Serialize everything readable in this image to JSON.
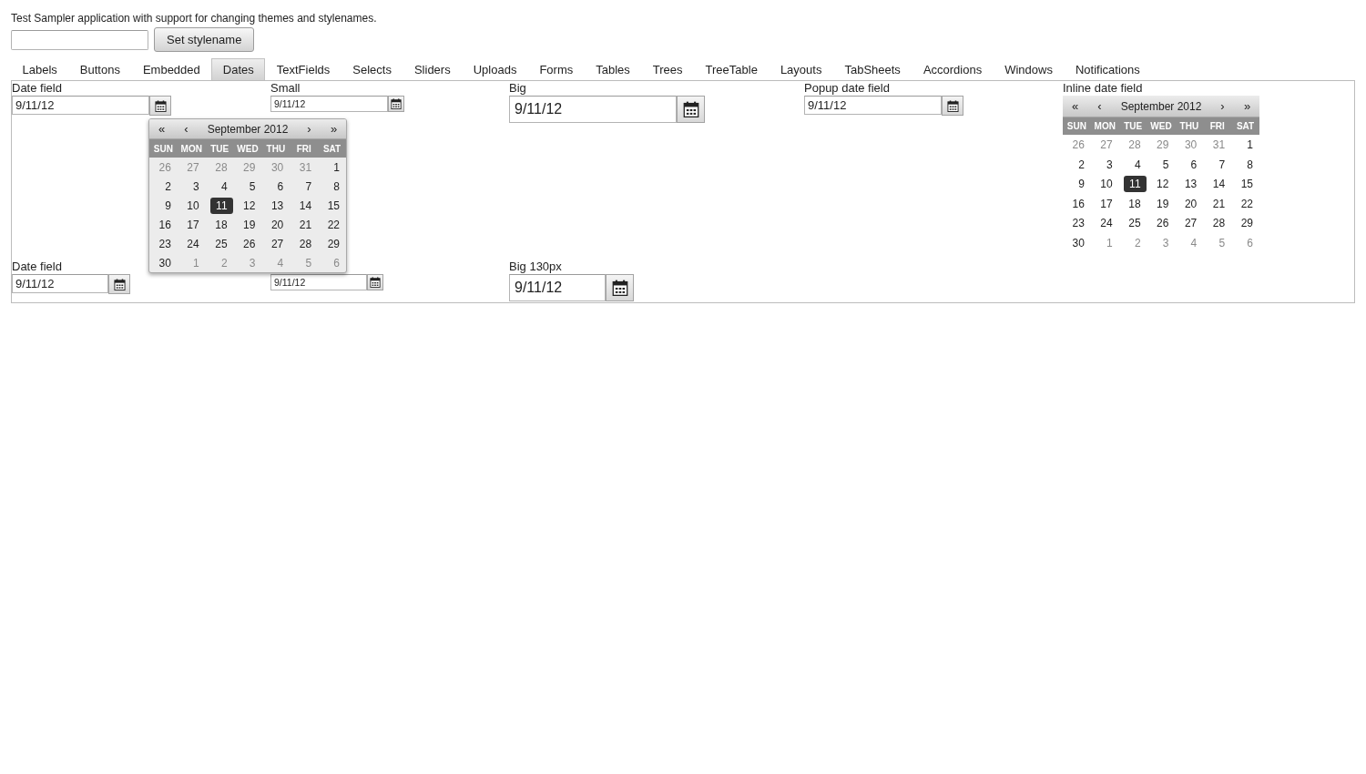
{
  "app": {
    "description": "Test Sampler application with support for changing themes and stylenames.",
    "stylename_button": "Set stylename"
  },
  "tabs": [
    {
      "label": "Labels",
      "selected": false
    },
    {
      "label": "Buttons",
      "selected": false
    },
    {
      "label": "Embedded",
      "selected": false
    },
    {
      "label": "Dates",
      "selected": true
    },
    {
      "label": "TextFields",
      "selected": false
    },
    {
      "label": "Selects",
      "selected": false
    },
    {
      "label": "Sliders",
      "selected": false
    },
    {
      "label": "Uploads",
      "selected": false
    },
    {
      "label": "Forms",
      "selected": false
    },
    {
      "label": "Tables",
      "selected": false
    },
    {
      "label": "Trees",
      "selected": false
    },
    {
      "label": "TreeTable",
      "selected": false
    },
    {
      "label": "Layouts",
      "selected": false
    },
    {
      "label": "TabSheets",
      "selected": false
    },
    {
      "label": "Accordions",
      "selected": false
    },
    {
      "label": "Windows",
      "selected": false
    },
    {
      "label": "Notifications",
      "selected": false
    }
  ],
  "rows": [
    [
      {
        "kind": "default",
        "label": "Date field",
        "value": "9/11/12",
        "popup_calendar": {
          "prev_year": "«",
          "prev_month": "‹",
          "title": "September 2012",
          "next_month": "›",
          "next_year": "»",
          "weekdays": [
            "SUN",
            "MON",
            "TUE",
            "WED",
            "THU",
            "FRI",
            "SAT"
          ],
          "weeks": [
            [
              {
                "day": "26",
                "other_month": true,
                "selected": false
              },
              {
                "day": "27",
                "other_month": true,
                "selected": false
              },
              {
                "day": "28",
                "other_month": true,
                "selected": false
              },
              {
                "day": "29",
                "other_month": true,
                "selected": false
              },
              {
                "day": "30",
                "other_month": true,
                "selected": false
              },
              {
                "day": "31",
                "other_month": true,
                "selected": false
              },
              {
                "day": "1",
                "other_month": false,
                "selected": false
              }
            ],
            [
              {
                "day": "2",
                "other_month": false,
                "selected": false
              },
              {
                "day": "3",
                "other_month": false,
                "selected": false
              },
              {
                "day": "4",
                "other_month": false,
                "selected": false
              },
              {
                "day": "5",
                "other_month": false,
                "selected": false
              },
              {
                "day": "6",
                "other_month": false,
                "selected": false
              },
              {
                "day": "7",
                "other_month": false,
                "selected": false
              },
              {
                "day": "8",
                "other_month": false,
                "selected": false
              }
            ],
            [
              {
                "day": "9",
                "other_month": false,
                "selected": false
              },
              {
                "day": "10",
                "other_month": false,
                "selected": false
              },
              {
                "day": "11",
                "other_month": false,
                "selected": true
              },
              {
                "day": "12",
                "other_month": false,
                "selected": false
              },
              {
                "day": "13",
                "other_month": false,
                "selected": false
              },
              {
                "day": "14",
                "other_month": false,
                "selected": false
              },
              {
                "day": "15",
                "other_month": false,
                "selected": false
              }
            ],
            [
              {
                "day": "16",
                "other_month": false,
                "selected": false
              },
              {
                "day": "17",
                "other_month": false,
                "selected": false
              },
              {
                "day": "18",
                "other_month": false,
                "selected": false
              },
              {
                "day": "19",
                "other_month": false,
                "selected": false
              },
              {
                "day": "20",
                "other_month": false,
                "selected": false
              },
              {
                "day": "21",
                "other_month": false,
                "selected": false
              },
              {
                "day": "22",
                "other_month": false,
                "selected": false
              }
            ],
            [
              {
                "day": "23",
                "other_month": false,
                "selected": false
              },
              {
                "day": "24",
                "other_month": false,
                "selected": false
              },
              {
                "day": "25",
                "other_month": false,
                "selected": false
              },
              {
                "day": "26",
                "other_month": false,
                "selected": false
              },
              {
                "day": "27",
                "other_month": false,
                "selected": false
              },
              {
                "day": "28",
                "other_month": false,
                "selected": false
              },
              {
                "day": "29",
                "other_month": false,
                "selected": false
              }
            ],
            [
              {
                "day": "30",
                "other_month": false,
                "selected": false
              },
              {
                "day": "1",
                "other_month": true,
                "selected": false
              },
              {
                "day": "2",
                "other_month": true,
                "selected": false
              },
              {
                "day": "3",
                "other_month": true,
                "selected": false
              },
              {
                "day": "4",
                "other_month": true,
                "selected": false
              },
              {
                "day": "5",
                "other_month": true,
                "selected": false
              },
              {
                "day": "6",
                "other_month": true,
                "selected": false
              }
            ]
          ]
        }
      },
      {
        "kind": "small",
        "label": "Small",
        "value": "9/11/12"
      },
      {
        "kind": "big",
        "label": "Big",
        "value": "9/11/12"
      },
      {
        "kind": "default",
        "label": "Popup date field",
        "value": "9/11/12"
      },
      {
        "kind": "inline",
        "label": "Inline date field",
        "calendar": {
          "prev_year": "«",
          "prev_month": "‹",
          "title": "September 2012",
          "next_month": "›",
          "next_year": "»",
          "weekdays": [
            "SUN",
            "MON",
            "TUE",
            "WED",
            "THU",
            "FRI",
            "SAT"
          ],
          "weeks": [
            [
              {
                "day": "26",
                "other_month": true,
                "selected": false
              },
              {
                "day": "27",
                "other_month": true,
                "selected": false
              },
              {
                "day": "28",
                "other_month": true,
                "selected": false
              },
              {
                "day": "29",
                "other_month": true,
                "selected": false
              },
              {
                "day": "30",
                "other_month": true,
                "selected": false
              },
              {
                "day": "31",
                "other_month": true,
                "selected": false
              },
              {
                "day": "1",
                "other_month": false,
                "selected": false
              }
            ],
            [
              {
                "day": "2",
                "other_month": false,
                "selected": false
              },
              {
                "day": "3",
                "other_month": false,
                "selected": false
              },
              {
                "day": "4",
                "other_month": false,
                "selected": false
              },
              {
                "day": "5",
                "other_month": false,
                "selected": false
              },
              {
                "day": "6",
                "other_month": false,
                "selected": false
              },
              {
                "day": "7",
                "other_month": false,
                "selected": false
              },
              {
                "day": "8",
                "other_month": false,
                "selected": false
              }
            ],
            [
              {
                "day": "9",
                "other_month": false,
                "selected": false
              },
              {
                "day": "10",
                "other_month": false,
                "selected": false
              },
              {
                "day": "11",
                "other_month": false,
                "selected": true
              },
              {
                "day": "12",
                "other_month": false,
                "selected": false
              },
              {
                "day": "13",
                "other_month": false,
                "selected": false
              },
              {
                "day": "14",
                "other_month": false,
                "selected": false
              },
              {
                "day": "15",
                "other_month": false,
                "selected": false
              }
            ],
            [
              {
                "day": "16",
                "other_month": false,
                "selected": false
              },
              {
                "day": "17",
                "other_month": false,
                "selected": false
              },
              {
                "day": "18",
                "other_month": false,
                "selected": false
              },
              {
                "day": "19",
                "other_month": false,
                "selected": false
              },
              {
                "day": "20",
                "other_month": false,
                "selected": false
              },
              {
                "day": "21",
                "other_month": false,
                "selected": false
              },
              {
                "day": "22",
                "other_month": false,
                "selected": false
              }
            ],
            [
              {
                "day": "23",
                "other_month": false,
                "selected": false
              },
              {
                "day": "24",
                "other_month": false,
                "selected": false
              },
              {
                "day": "25",
                "other_month": false,
                "selected": false
              },
              {
                "day": "26",
                "other_month": false,
                "selected": false
              },
              {
                "day": "27",
                "other_month": false,
                "selected": false
              },
              {
                "day": "28",
                "other_month": false,
                "selected": false
              },
              {
                "day": "29",
                "other_month": false,
                "selected": false
              }
            ],
            [
              {
                "day": "30",
                "other_month": false,
                "selected": false
              },
              {
                "day": "1",
                "other_month": true,
                "selected": false
              },
              {
                "day": "2",
                "other_month": true,
                "selected": false
              },
              {
                "day": "3",
                "other_month": true,
                "selected": false
              },
              {
                "day": "4",
                "other_month": true,
                "selected": false
              },
              {
                "day": "5",
                "other_month": true,
                "selected": false
              },
              {
                "day": "6",
                "other_month": true,
                "selected": false
              }
            ]
          ]
        }
      }
    ],
    [
      {
        "kind": "default",
        "label": "Date field",
        "value": "9/11/12"
      },
      {
        "kind": "small",
        "value": "9/11/12"
      },
      {
        "kind": "big",
        "label": "Big 130px",
        "value": "9/11/12"
      }
    ]
  ]
}
